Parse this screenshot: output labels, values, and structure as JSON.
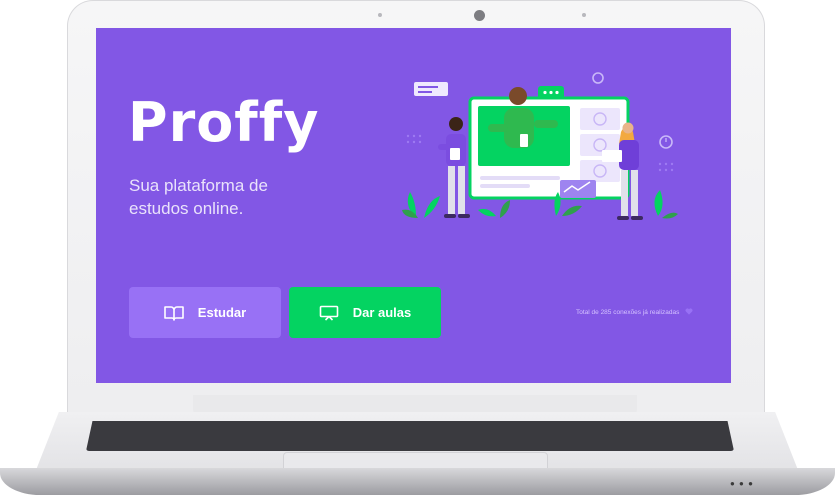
{
  "app": {
    "logo_text": "Proffy",
    "tagline": "Sua plataforma de estudos online."
  },
  "actions": {
    "study": {
      "label": "Estudar",
      "icon": "book-open-icon"
    },
    "teach": {
      "label": "Dar aulas",
      "icon": "presentation-board-icon"
    }
  },
  "footer": {
    "total_connections_text": "Total de 285 conexões já realizadas",
    "heart_icon": "purple-heart-icon"
  },
  "colors": {
    "background": "#8257e5",
    "primary_light": "#9871f5",
    "secondary": "#04d361",
    "text_in_primary": "#ffffff"
  }
}
